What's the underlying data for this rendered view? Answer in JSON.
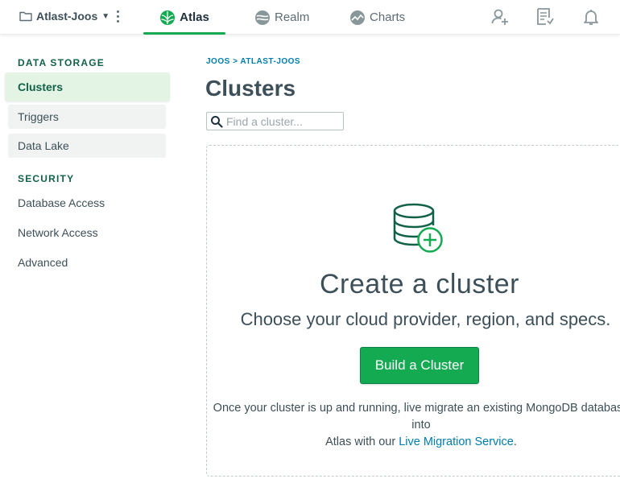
{
  "topbar": {
    "project_name": "Atlast-Joos",
    "tabs": [
      {
        "label": "Atlas",
        "icon": "atlas-leaf-icon",
        "active": true
      },
      {
        "label": "Realm",
        "icon": "realm-icon",
        "active": false
      },
      {
        "label": "Charts",
        "icon": "charts-icon",
        "active": false
      }
    ],
    "right_icons": [
      "invite-user-icon",
      "activity-feed-icon",
      "bell-icon"
    ]
  },
  "sidebar": {
    "data_storage_heading": "DATA STORAGE",
    "data_storage_items": [
      {
        "label": "Clusters",
        "active": true
      },
      {
        "label": "Triggers",
        "active": false
      },
      {
        "label": "Data Lake",
        "active": false
      }
    ],
    "security_heading": "SECURITY",
    "security_items": [
      {
        "label": "Database Access"
      },
      {
        "label": "Network Access"
      },
      {
        "label": "Advanced"
      }
    ]
  },
  "main": {
    "breadcrumb": {
      "org": "JOOS",
      "separator": ">",
      "project": "ATLAST-JOOS"
    },
    "title": "Clusters",
    "search_placeholder": "Find a cluster...",
    "empty_state": {
      "icon": "database-plus-icon",
      "title": "Create a cluster",
      "subtitle": "Choose your cloud provider, region, and specs.",
      "button_label": "Build a Cluster",
      "migrate_text_1": "Once your cluster is up and running, live migrate an existing MongoDB database into",
      "migrate_text_2": "Atlas with our",
      "migrate_link": "Live Migration Service",
      "migrate_end": "."
    }
  },
  "colors": {
    "brand_green": "#13aa52",
    "dark_green": "#116149",
    "link_blue": "#007cad",
    "text": "#3d4f58"
  }
}
